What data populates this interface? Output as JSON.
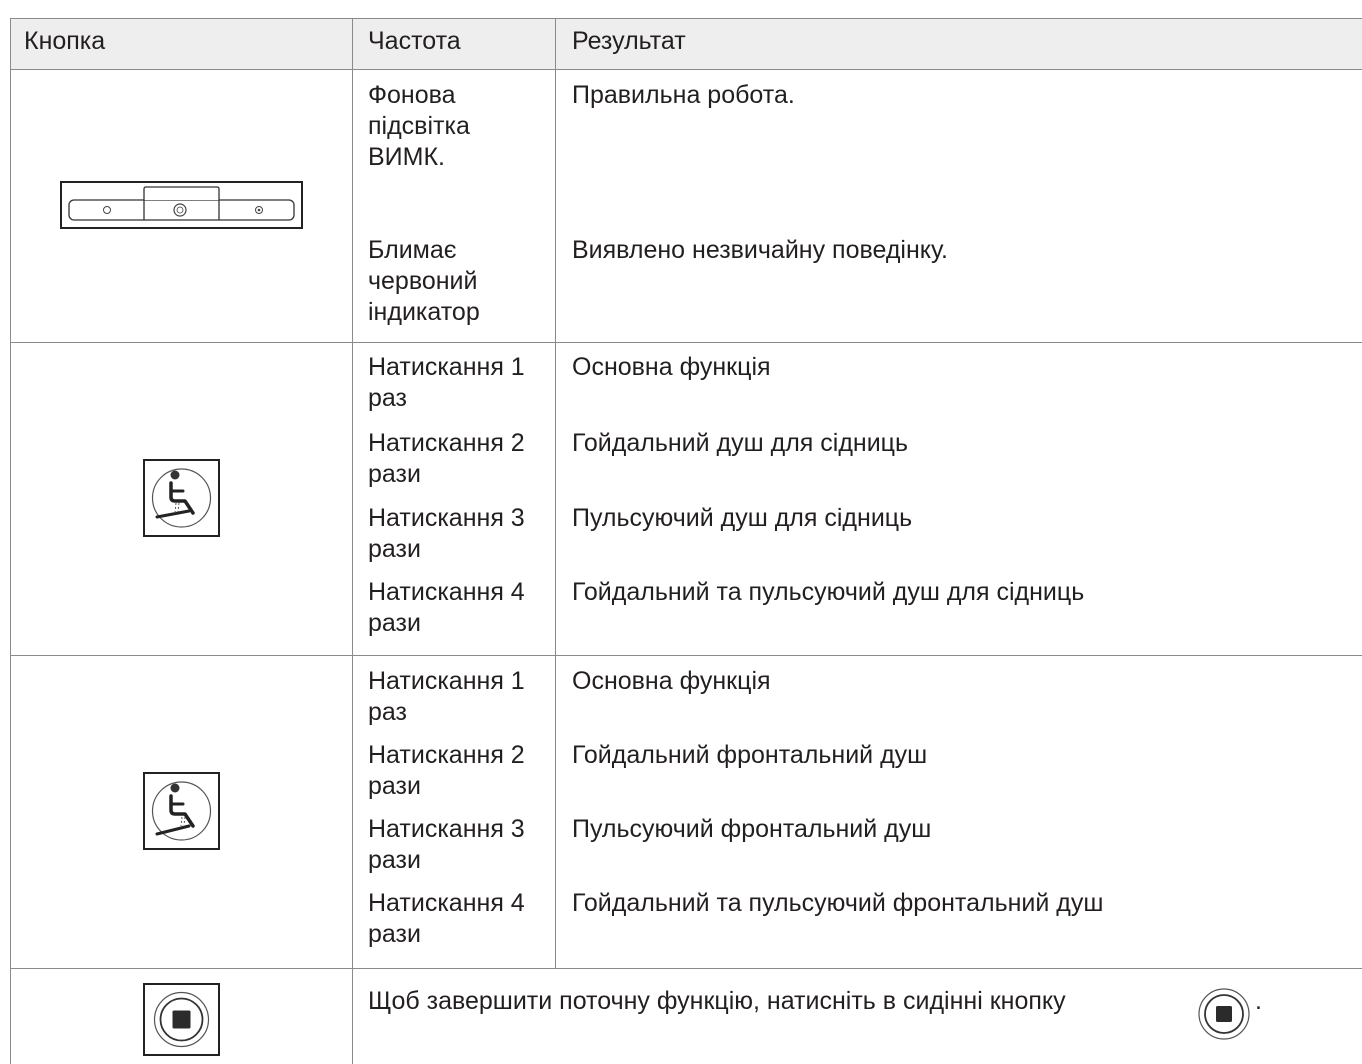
{
  "header": {
    "col_button": "Кнопка",
    "col_frequency": "Частота",
    "col_result": "Результат"
  },
  "rows": [
    {
      "icon": "control-panel-icon",
      "entries": [
        {
          "frequency": "Фонова підсвітка ВИМК.",
          "result": "Правильна робота."
        },
        {
          "frequency": "Блимає червоний індикатор",
          "result": "Виявлено незвичайну поведінку."
        }
      ]
    },
    {
      "icon": "rear-shower-icon",
      "entries": [
        {
          "frequency": "Натискання 1 раз",
          "result": "Основна функція"
        },
        {
          "frequency": "Натискання 2 рази",
          "result": "Гойдальний душ для сідниць"
        },
        {
          "frequency": "Натискання 3 рази",
          "result": "Пульсуючий душ для сідниць"
        },
        {
          "frequency": "Натискання 4 рази",
          "result": "Гойдальний та пульсуючий душ для сідниць"
        }
      ]
    },
    {
      "icon": "front-shower-icon",
      "entries": [
        {
          "frequency": "Натискання 1 раз",
          "result": "Основна функція"
        },
        {
          "frequency": "Натискання 2 рази",
          "result": "Гойдальний фронтальний душ"
        },
        {
          "frequency": "Натискання 3 рази",
          "result": "Пульсуючий фронтальний душ"
        },
        {
          "frequency": "Натискання 4 рази",
          "result": "Гойдальний та пульсуючий фронтальний душ"
        }
      ]
    },
    {
      "icon": "stop-icon",
      "note_text": "Щоб завершити поточну функцію, натисніть в сидінні кнопку",
      "note_end": ".",
      "inline_icon": "stop-icon"
    }
  ]
}
